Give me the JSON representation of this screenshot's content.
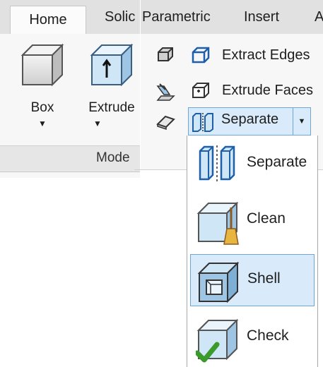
{
  "tabs_left": {
    "home": "Home",
    "solid": "Solic"
  },
  "tabs_right": {
    "parametric": "Parametric",
    "insert": "Insert",
    "overflow": "A"
  },
  "modeling": {
    "box": {
      "label": "Box",
      "icon": "box-icon"
    },
    "extrude": {
      "label": "Extrude",
      "icon": "extrude-icon"
    },
    "panel_title": "Mode"
  },
  "solid_editing": {
    "extract_edges": "Extract Edges",
    "extrude_faces": "Extrude Faces",
    "separate": "Separate"
  },
  "dropdown": [
    {
      "label": "Separate",
      "icon": "separate-icon"
    },
    {
      "label": "Clean",
      "icon": "clean-icon"
    },
    {
      "label": "Shell",
      "icon": "shell-icon",
      "selected": true
    },
    {
      "label": "Check",
      "icon": "check-icon"
    }
  ],
  "colors": {
    "accent": "#d9ebfa",
    "accent_border": "#6fa6d6",
    "icon_blue": "#1f5fa8",
    "check_green": "#3a9a2a"
  }
}
